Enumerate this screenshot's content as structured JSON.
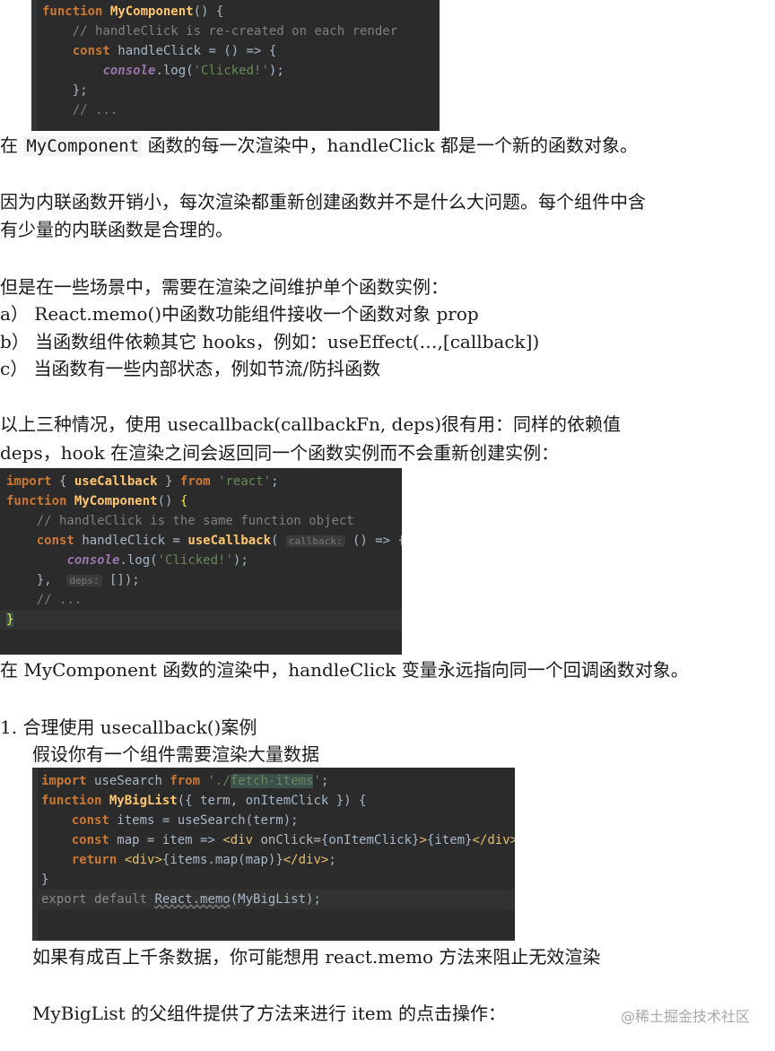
{
  "code1": {
    "lines": [
      "function MyComponent() {",
      "    // handleClick is re-created on each render",
      "    const handleClick = () => {",
      "        console.log('Clicked!');",
      "    };",
      "    // ..."
    ]
  },
  "p1": {
    "prefix": "在",
    "code": "MyComponent",
    "suffix": "函数的每一次渲染中，handleClick 都是一个新的函数对象。"
  },
  "p2": {
    "line1": "因为内联函数开销小，每次渲染都重新创建函数并不是什么大问题。每个组件中含",
    "line2": "有少量的内联函数是合理的。"
  },
  "p3": {
    "intro": "但是在一些场景中，需要在渲染之间维护单个函数实例：",
    "items": [
      "a） React.memo()中函数功能组件接收一个函数对象 prop",
      "b） 当函数组件依赖其它 hooks，例如：useEffect(…,[callback])",
      "c） 当函数有一些内部状态，例如节流/防抖函数"
    ]
  },
  "p4": {
    "line1": "以上三种情况，使用 usecallback(callbackFn, deps)很有用：同样的依赖值",
    "line2": "deps，hook 在渲染之间会返回同一个函数实例而不会重新创建实例："
  },
  "code2": {
    "import_kw": "import",
    "import_name": "useCallback",
    "from_kw": "from",
    "module": "'react'",
    "comment": "// handleClick is the same function object",
    "use_callback": "useCallback",
    "hint_callback": "callback:",
    "console_word": "console",
    "log_call": ".log(",
    "clicked": "'Clicked!'",
    "hint_deps": "deps:",
    "ellipsis_comment": "// ...",
    "fn_kw": "function",
    "fn_name": "MyComponent",
    "const_kw": "const",
    "handle_click": "handleClick"
  },
  "p5": {
    "text": "在 MyComponent 函数的渲染中，handleClick 变量永远指向同一个回调函数对象。"
  },
  "p6": {
    "heading": "1.  合理使用 usecallback()案例",
    "sub": "假设你有一个组件需要渲染大量数据"
  },
  "code3": {
    "import_kw": "import",
    "use_search": "useSearch",
    "from_kw": "from",
    "module_prefix": "'./",
    "module_hl": "fetch-items",
    "module_suffix": "'",
    "fn_kw": "function",
    "fn_name": "MyBigList",
    "params": "({ term, onItemClick }) {",
    "const_kw": "const",
    "items_line": " items = useSearch(term);",
    "map_line_a": " map = item => ",
    "div_open": "<div",
    "onclick_attr": " onClick=",
    "onclick_val": "{onItemClick}",
    "gt": ">",
    "item_expr": "{item}",
    "div_close": "</div>",
    "semicolon": ";",
    "return_kw": "return",
    "return_expr": "{items.map(map)}",
    "export_line_a": "export default ",
    "react_memo": "React.memo",
    "export_arg": "(MyBigList)",
    "export_end": ";"
  },
  "p7": {
    "text": "如果有成百上千条数据，你可能想用 react.memo 方法来阻止无效渲染"
  },
  "p8": {
    "text": "MyBigList 的父组件提供了方法来进行 item 的点击操作："
  },
  "watermark": "@稀土掘金技术社区"
}
